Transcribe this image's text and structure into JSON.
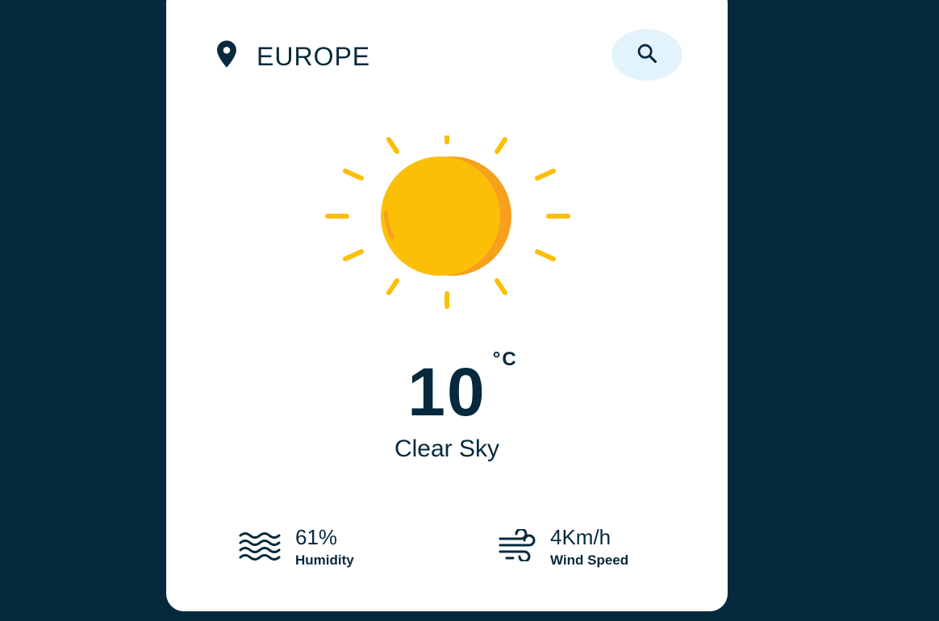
{
  "location": {
    "name": "EUROPE",
    "icon": "map-pin-icon"
  },
  "search": {
    "icon": "search-icon"
  },
  "weather": {
    "icon": "sun-icon",
    "temperature": "10",
    "unit": "°C",
    "condition": "Clear Sky"
  },
  "stats": {
    "humidity": {
      "value": "61%",
      "label": "Humidity",
      "icon": "humidity-waves-icon"
    },
    "wind": {
      "value": "4Km/h",
      "label": "Wind Speed",
      "icon": "wind-icon"
    }
  },
  "colors": {
    "background": "#06293d",
    "card": "#ffffff",
    "text": "#06293d",
    "search_bg": "#e3f3fb",
    "sun_yellow": "#fbbf08",
    "sun_orange": "#f7a01c"
  }
}
